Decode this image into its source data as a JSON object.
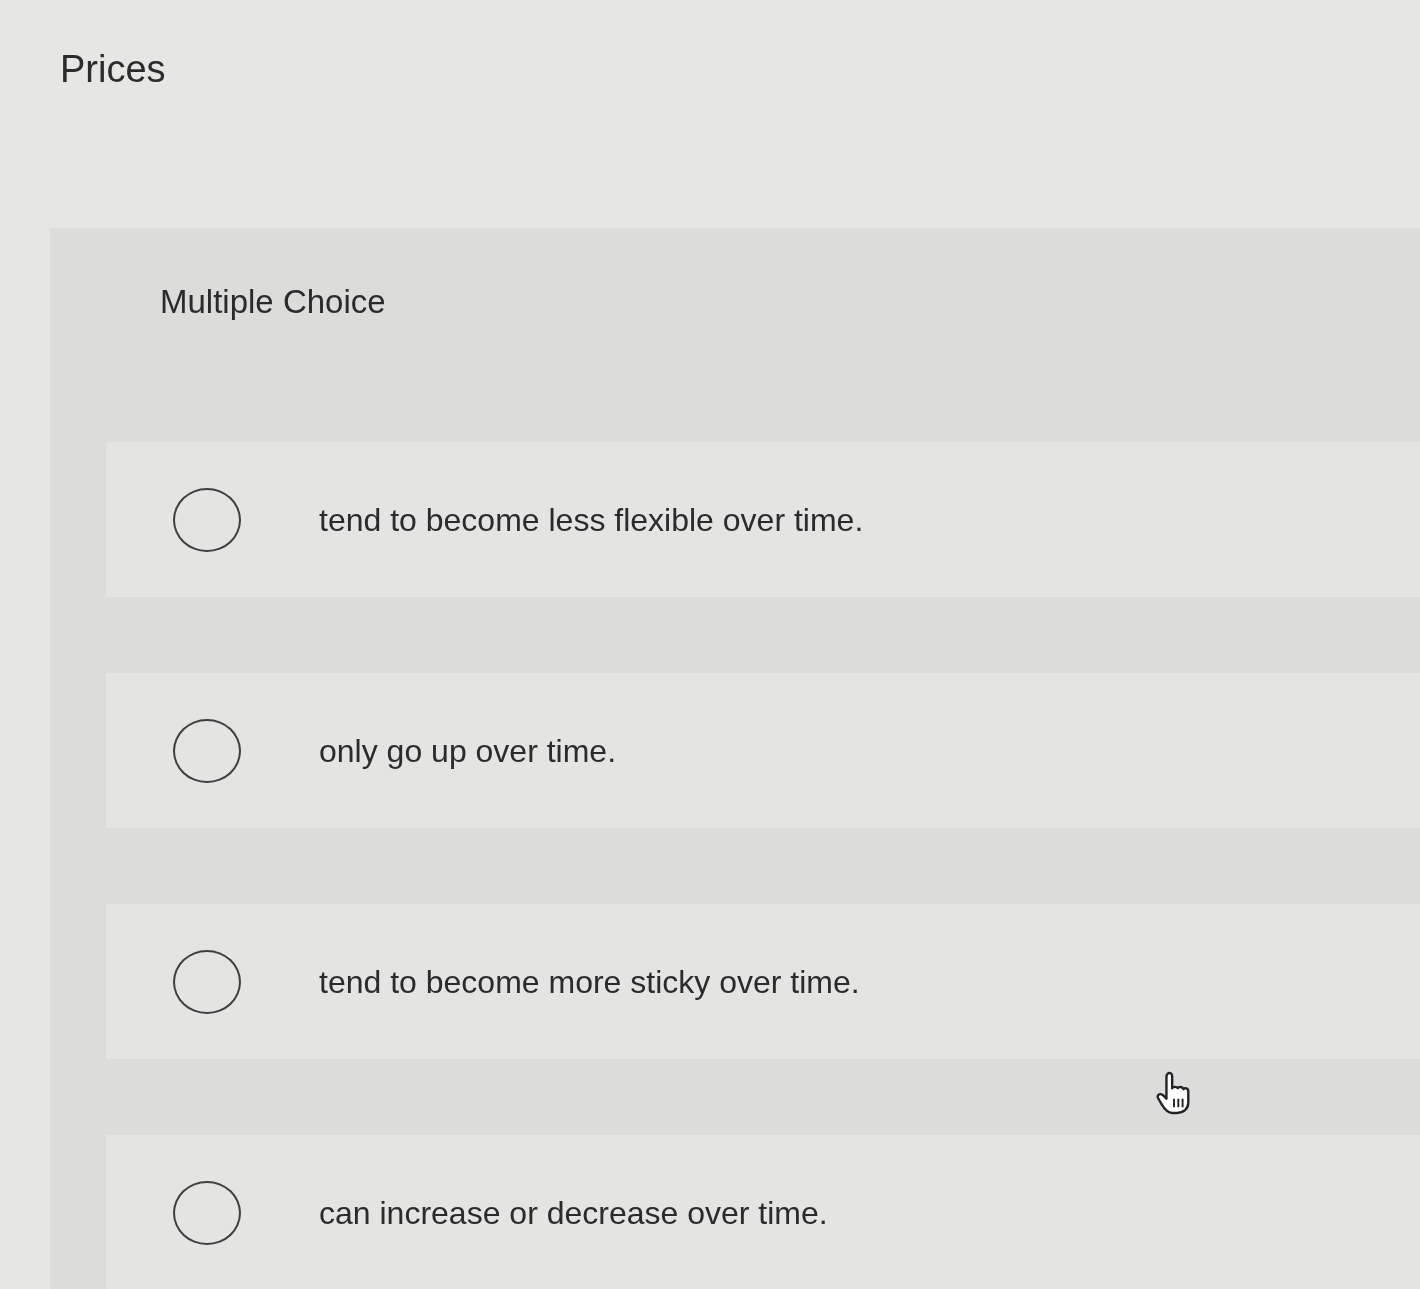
{
  "title": "Prices",
  "question": {
    "type_label": "Multiple Choice",
    "choices": [
      {
        "text": "tend to become less flexible over time.",
        "selected": false
      },
      {
        "text": "only go up over time.",
        "selected": false
      },
      {
        "text": "tend to become more sticky over time.",
        "selected": false
      },
      {
        "text": "can increase or decrease over time.",
        "selected": false
      }
    ]
  }
}
